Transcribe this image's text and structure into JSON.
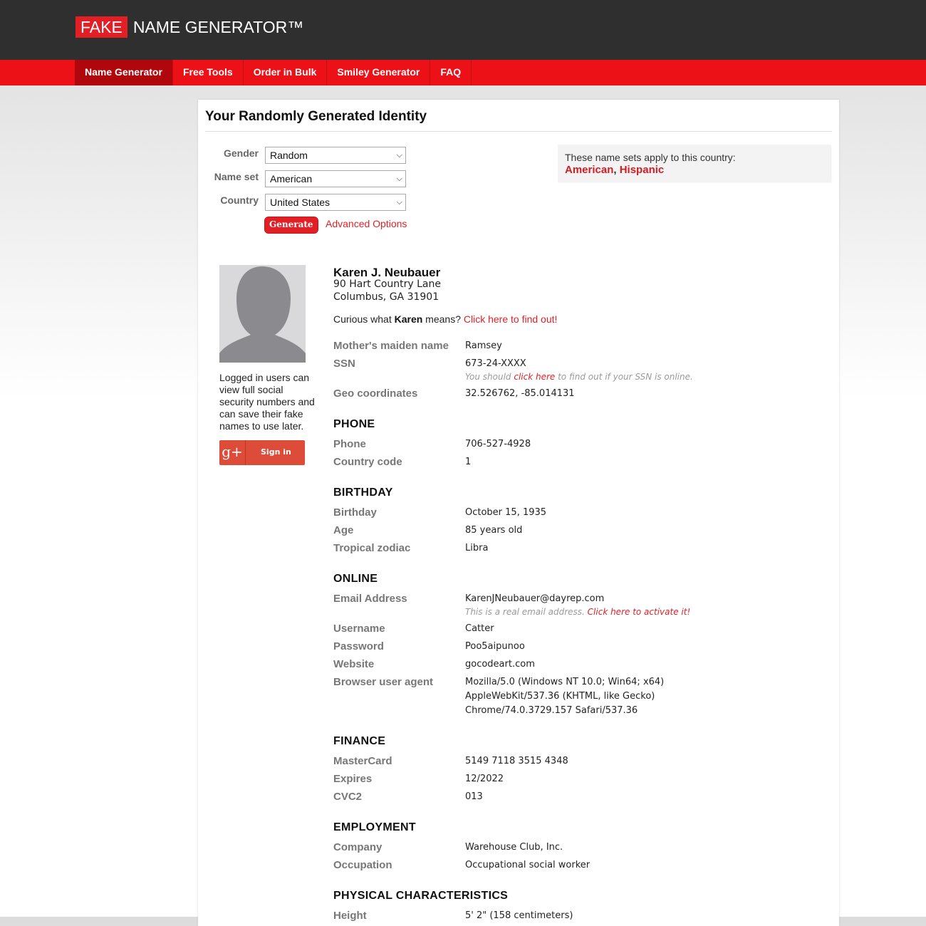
{
  "logo": {
    "fake": "FAKE",
    "rest": "NAME GENERATOR™"
  },
  "nav": [
    "Name Generator",
    "Free Tools",
    "Order in Bulk",
    "Smiley Generator",
    "FAQ"
  ],
  "page_title": "Your Randomly Generated Identity",
  "form": {
    "gender_label": "Gender",
    "gender_value": "Random",
    "nameset_label": "Name set",
    "nameset_value": "American",
    "country_label": "Country",
    "country_value": "United States",
    "generate": "Generate",
    "advanced": "Advanced Options"
  },
  "country_box": {
    "text": "These name sets apply to this country:",
    "set1": "American",
    "sep": ", ",
    "set2": "Hispanic"
  },
  "sidebar": {
    "note": "Logged in users can view full social security numbers and can save their fake names to use later.",
    "gplus_icon": "g+",
    "signin": "Sign in"
  },
  "identity": {
    "name": "Karen J. Neubauer",
    "address1": "90 Hart Country Lane",
    "address2": "Columbus, GA 31901",
    "curious_pre": "Curious what ",
    "curious_name": "Karen",
    "curious_post": " means? ",
    "curious_link": "Click here to find out!"
  },
  "details": {
    "maiden_label": "Mother's maiden name",
    "maiden": "Ramsey",
    "ssn_label": "SSN",
    "ssn": "673-24-XXXX",
    "ssn_note_pre": "You should ",
    "ssn_note_link": "click here",
    "ssn_note_post": " to find out if your SSN is online.",
    "geo_label": "Geo coordinates",
    "geo": "32.526762, -85.014131"
  },
  "phone": {
    "title": "PHONE",
    "phone_label": "Phone",
    "phone": "706-527-4928",
    "cc_label": "Country code",
    "cc": "1"
  },
  "birthday": {
    "title": "BIRTHDAY",
    "bday_label": "Birthday",
    "bday": "October 15, 1935",
    "age_label": "Age",
    "age": "85 years old",
    "zodiac_label": "Tropical zodiac",
    "zodiac": "Libra"
  },
  "online": {
    "title": "ONLINE",
    "email_label": "Email Address",
    "email": "KarenJNeubauer@dayrep.com",
    "email_note_pre": "This is a real email address. ",
    "email_note_link": "Click here to activate it!",
    "user_label": "Username",
    "user": "Catter",
    "pass_label": "Password",
    "pass": "Poo5aipunoo",
    "web_label": "Website",
    "web": "gocodeart.com",
    "ua_label": "Browser user agent",
    "ua1": "Mozilla/5.0 (Windows NT 10.0; Win64; x64)",
    "ua2": "AppleWebKit/537.36 (KHTML, like Gecko)",
    "ua3": "Chrome/74.0.3729.157 Safari/537.36"
  },
  "finance": {
    "title": "FINANCE",
    "mc_label": "MasterCard",
    "mc": "5149 7118 3515 4348",
    "exp_label": "Expires",
    "exp": "12/2022",
    "cvc_label": "CVC2",
    "cvc": "013"
  },
  "employment": {
    "title": "EMPLOYMENT",
    "company_label": "Company",
    "company": "Warehouse Club, Inc.",
    "occ_label": "Occupation",
    "occ": "Occupational social worker"
  },
  "physical": {
    "title": "PHYSICAL CHARACTERISTICS",
    "height_label": "Height",
    "height": "5' 2\" (158 centimeters)"
  }
}
